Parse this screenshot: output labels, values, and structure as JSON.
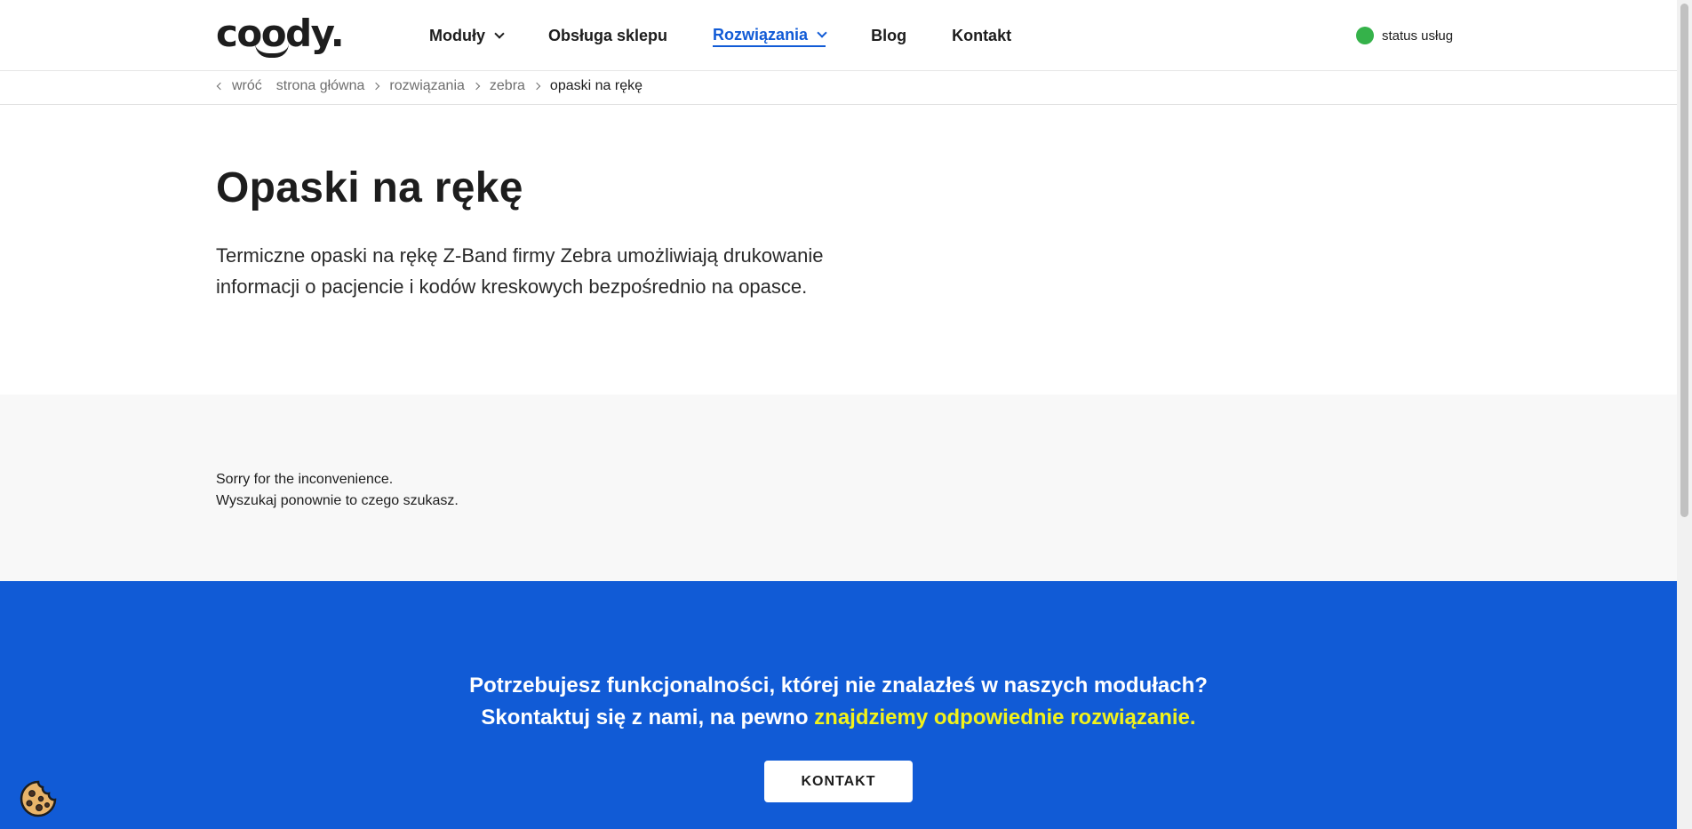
{
  "header": {
    "logo": "coody.",
    "nav": [
      {
        "label": "Moduły",
        "has_dropdown": true
      },
      {
        "label": "Obsługa sklepu",
        "has_dropdown": false
      },
      {
        "label": "Rozwiązania",
        "has_dropdown": true,
        "active": true
      },
      {
        "label": "Blog",
        "has_dropdown": false
      },
      {
        "label": "Kontakt",
        "has_dropdown": false
      }
    ],
    "status_label": "status usług",
    "status_color": "#35b24a"
  },
  "breadcrumb": {
    "back": "wróć",
    "items": [
      "strona główna",
      "rozwiązania",
      "zebra"
    ],
    "current": "opaski na rękę"
  },
  "hero": {
    "title": "Opaski na rękę",
    "description": "Termiczne opaski na rękę Z-Band firmy Zebra umożliwiają drukowanie informacji o pacjencie i kodów kreskowych bezpośrednio na opasce."
  },
  "notice": {
    "line1": "Sorry for the inconvenience.",
    "line2": "Wyszukaj ponownie to czego szukasz."
  },
  "cta": {
    "line1": "Potrzebujesz funkcjonalności, której nie znalazłeś w naszych modułach?",
    "line2_prefix": "Skontaktuj się z nami, na pewno ",
    "line2_highlight": "znajdziemy odpowiednie rozwiązanie.",
    "button": "KONTAKT",
    "background": "#115bd6",
    "highlight_color": "#f2f21a"
  },
  "icons": {
    "cookie": "cookie-icon",
    "status": "status-dot-icon"
  }
}
